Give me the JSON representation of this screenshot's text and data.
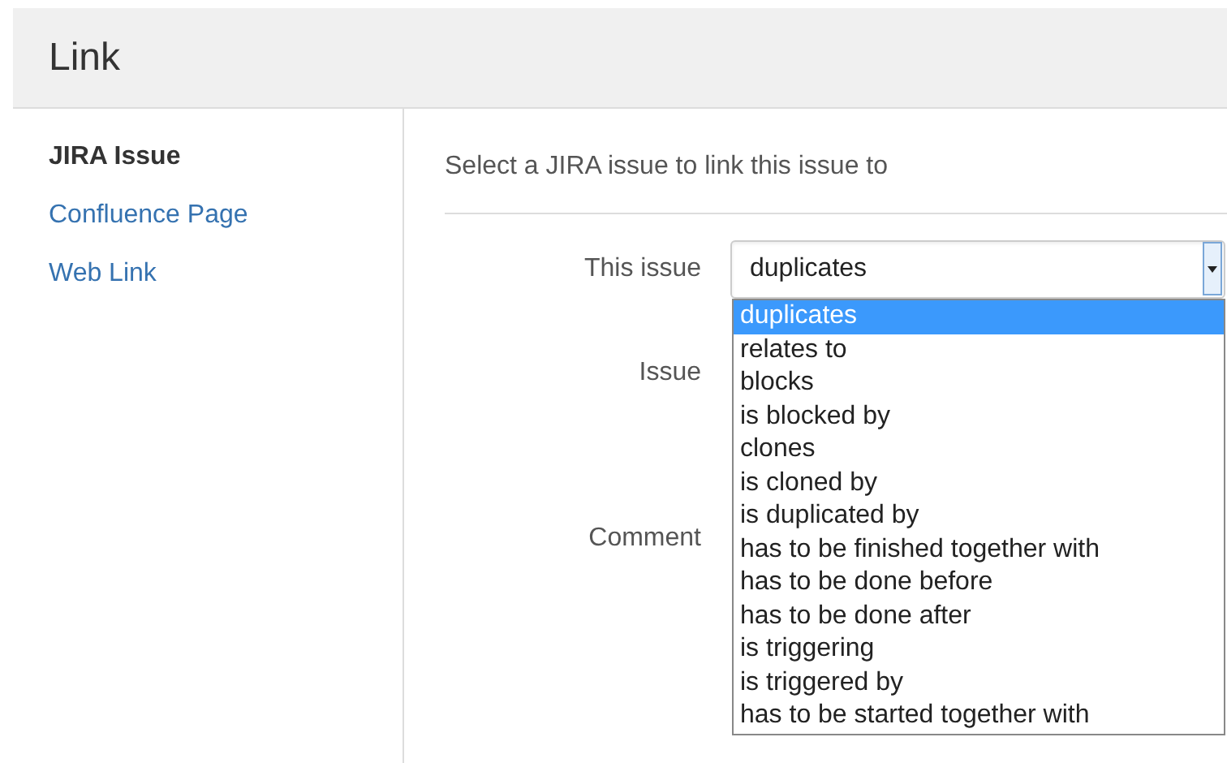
{
  "header": {
    "title": "Link"
  },
  "sidebar": {
    "items": [
      {
        "label": "JIRA Issue",
        "selected": true
      },
      {
        "label": "Confluence Page",
        "selected": false
      },
      {
        "label": "Web Link",
        "selected": false
      }
    ]
  },
  "intro": "Select a JIRA issue to link this issue to",
  "form": {
    "labels": [
      "This issue",
      "Issue",
      "Comment"
    ],
    "select": {
      "value": "duplicates",
      "expanded": true,
      "options": [
        {
          "label": "duplicates",
          "selected": true
        },
        {
          "label": "relates to",
          "selected": false
        },
        {
          "label": "blocks",
          "selected": false
        },
        {
          "label": "is blocked by",
          "selected": false
        },
        {
          "label": "clones",
          "selected": false
        },
        {
          "label": "is cloned by",
          "selected": false
        },
        {
          "label": "is duplicated by",
          "selected": false
        },
        {
          "label": "has to be finished together with",
          "selected": false
        },
        {
          "label": "has to be done before",
          "selected": false
        },
        {
          "label": "has to be done after",
          "selected": false
        },
        {
          "label": "is triggering",
          "selected": false
        },
        {
          "label": "is triggered by",
          "selected": false
        },
        {
          "label": "has to be started together with",
          "selected": false
        }
      ]
    }
  }
}
